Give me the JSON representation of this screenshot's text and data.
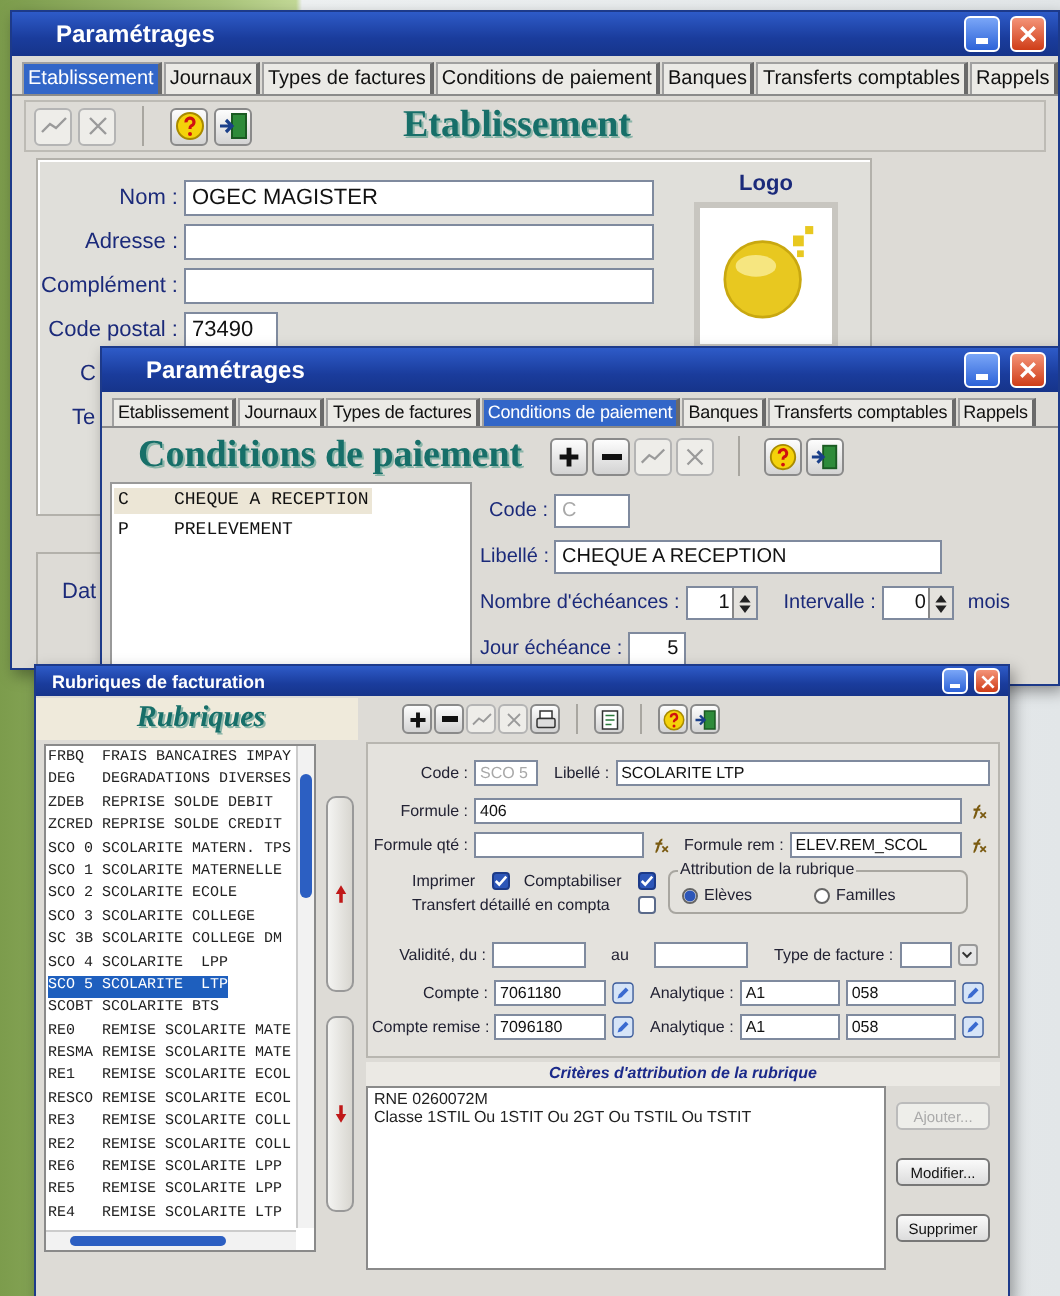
{
  "window_etablissement": {
    "title": "Paramétrages",
    "tabs": [
      {
        "label": "Etablissement",
        "selected": true
      },
      {
        "label": "Journaux",
        "selected": false
      },
      {
        "label": "Types de factures",
        "selected": false
      },
      {
        "label": "Conditions de paiement",
        "selected": false
      },
      {
        "label": "Banques",
        "selected": false
      },
      {
        "label": "Transferts comptables",
        "selected": false
      },
      {
        "label": "Rappels",
        "selected": false
      }
    ],
    "toolbar": [
      {
        "kind": "validate",
        "disabled": true
      },
      {
        "kind": "cancel",
        "disabled": true
      },
      {
        "kind": "help",
        "disabled": false
      },
      {
        "kind": "exit",
        "disabled": false
      }
    ],
    "heading": "Etablissement",
    "fields": [
      {
        "label": "Nom :",
        "value": "OGEC MAGISTER"
      },
      {
        "label": "Adresse :"
      },
      {
        "label": "Complément :"
      },
      {
        "label": "Code postal :",
        "value": "73490"
      }
    ],
    "partial_labels": [
      "C",
      "Te"
    ],
    "logo_label": "Logo",
    "lower_partial_label": "Dat"
  },
  "window_conditions": {
    "title": "Paramétrages",
    "tabs": [
      {
        "label": "Etablissement",
        "selected": false
      },
      {
        "label": "Journaux",
        "selected": false
      },
      {
        "label": "Types de factures",
        "selected": false
      },
      {
        "label": "Conditions de paiement",
        "selected": true
      },
      {
        "label": "Banques",
        "selected": false
      },
      {
        "label": "Transferts comptables",
        "selected": false
      },
      {
        "label": "Rappels",
        "selected": false
      }
    ],
    "heading": "Conditions de paiement",
    "toolbar": [
      {
        "kind": "add",
        "disabled": false
      },
      {
        "kind": "remove",
        "disabled": false
      },
      {
        "kind": "validate",
        "disabled": true
      },
      {
        "kind": "cancel",
        "disabled": true
      },
      {
        "kind": "help",
        "disabled": false
      },
      {
        "kind": "exit",
        "disabled": false
      }
    ],
    "list": [
      {
        "code": "C",
        "label": "CHEQUE A RECEPTION",
        "selected": true
      },
      {
        "code": "P",
        "label": "PRELEVEMENT",
        "selected": false
      }
    ],
    "form": {
      "code": {
        "label": "Code :",
        "value": "C",
        "disabled": true
      },
      "libelle": {
        "label": "Libellé :",
        "value": "CHEQUE A RECEPTION"
      },
      "echeances": {
        "label": "Nombre d'échéances :",
        "value": "1"
      },
      "intervalle": {
        "label": "Intervalle :",
        "value": "0",
        "unit": "mois"
      },
      "jour": {
        "label": "Jour échéance :",
        "value": "5"
      }
    }
  },
  "window_rubriques": {
    "title": "Rubriques de facturation",
    "heading": "Rubriques",
    "toolbar": [
      {
        "kind": "add",
        "disabled": false
      },
      {
        "kind": "remove",
        "disabled": false
      },
      {
        "kind": "validate",
        "disabled": true
      },
      {
        "kind": "cancel",
        "disabled": true
      },
      {
        "kind": "print",
        "disabled": false
      },
      {
        "kind": "copy",
        "disabled": false
      },
      {
        "kind": "help",
        "disabled": false
      },
      {
        "kind": "exit",
        "disabled": false
      }
    ],
    "list": [
      {
        "code": "FRBQ",
        "label": "FRAIS BANCAIRES IMPAY",
        "selected": false
      },
      {
        "code": "DEG",
        "label": "DEGRADATIONS DIVERSES",
        "selected": false
      },
      {
        "code": "ZDEB",
        "label": "REPRISE SOLDE DEBIT",
        "selected": false
      },
      {
        "code": "ZCRED",
        "label": "REPRISE SOLDE CREDIT",
        "selected": false
      },
      {
        "code": "SCO 0",
        "label": "SCOLARITE MATERN. TPS",
        "selected": false
      },
      {
        "code": "SCO 1",
        "label": "SCOLARITE MATERNELLE",
        "selected": false
      },
      {
        "code": "SCO 2",
        "label": "SCOLARITE ECOLE",
        "selected": false
      },
      {
        "code": "SCO 3",
        "label": "SCOLARITE COLLEGE",
        "selected": false
      },
      {
        "code": "SC 3B",
        "label": "SCOLARITE COLLEGE DM",
        "selected": false
      },
      {
        "code": "SCO 4",
        "label": "SCOLARITE  LPP",
        "selected": false
      },
      {
        "code": "SCO 5",
        "label": "SCOLARITE  LTP",
        "selected": true
      },
      {
        "code": "SCOBT",
        "label": "SCOLARITE BTS",
        "selected": false
      },
      {
        "code": "RE0",
        "label": "REMISE SCOLARITE MATE",
        "selected": false
      },
      {
        "code": "RESMA",
        "label": "REMISE SCOLARITE MATE",
        "selected": false
      },
      {
        "code": "RE1",
        "label": "REMISE SCOLARITE ECOL",
        "selected": false
      },
      {
        "code": "RESCO",
        "label": "REMISE SCOLARITE ECOL",
        "selected": false
      },
      {
        "code": "RE3",
        "label": "REMISE SCOLARITE COLL",
        "selected": false
      },
      {
        "code": "RE2",
        "label": "REMISE SCOLARITE COLL",
        "selected": false
      },
      {
        "code": "RE6",
        "label": "REMISE SCOLARITE LPP",
        "selected": false
      },
      {
        "code": "RE5",
        "label": "REMISE SCOLARITE LPP",
        "selected": false
      },
      {
        "code": "RE4",
        "label": "REMISE SCOLARITE LTP",
        "selected": false
      }
    ],
    "form": {
      "code": {
        "label": "Code :",
        "value": "SCO 5",
        "disabled": true
      },
      "libelle": {
        "label": "Libellé :",
        "value": "SCOLARITE  LTP"
      },
      "formule": {
        "label": "Formule :",
        "value": "406"
      },
      "formule_qte": {
        "label": "Formule qté :"
      },
      "formule_rem": {
        "label": "Formule rem :",
        "value": "ELEV.REM_SCOL"
      },
      "checks": [
        {
          "label": "Imprimer",
          "checked": true
        },
        {
          "label": "Comptabiliser",
          "checked": true
        },
        {
          "label": "Transfert détaillé en compta",
          "checked": false
        }
      ],
      "attribution": {
        "title": "Attribution de la rubrique",
        "options": [
          {
            "label": "Elèves",
            "selected": true
          },
          {
            "label": "Familles",
            "selected": false
          }
        ]
      },
      "validite": {
        "label": "Validité, du :",
        "between": "au"
      },
      "type_facture": {
        "label": "Type de facture :"
      },
      "accounts": [
        {
          "label": "Compte :",
          "value": "7061180",
          "analytic_label": "Analytique :",
          "analytic_1": "A1",
          "analytic_2": "058"
        },
        {
          "label": "Compte remise :",
          "value": "7096180",
          "analytic_label": "Analytique :",
          "analytic_1": "A1",
          "analytic_2": "058"
        }
      ]
    },
    "criteria": {
      "title": "Critères d'attribution de la rubrique",
      "lines": [
        "RNE 0260072M",
        "Classe 1STIL Ou 1STIT Ou 2GT Ou TSTIL Ou TSTIT"
      ]
    },
    "buttons": [
      {
        "label": "Ajouter...",
        "disabled": true
      },
      {
        "label": "Modifier...",
        "disabled": false
      },
      {
        "label": "Supprimer",
        "disabled": false
      }
    ]
  }
}
